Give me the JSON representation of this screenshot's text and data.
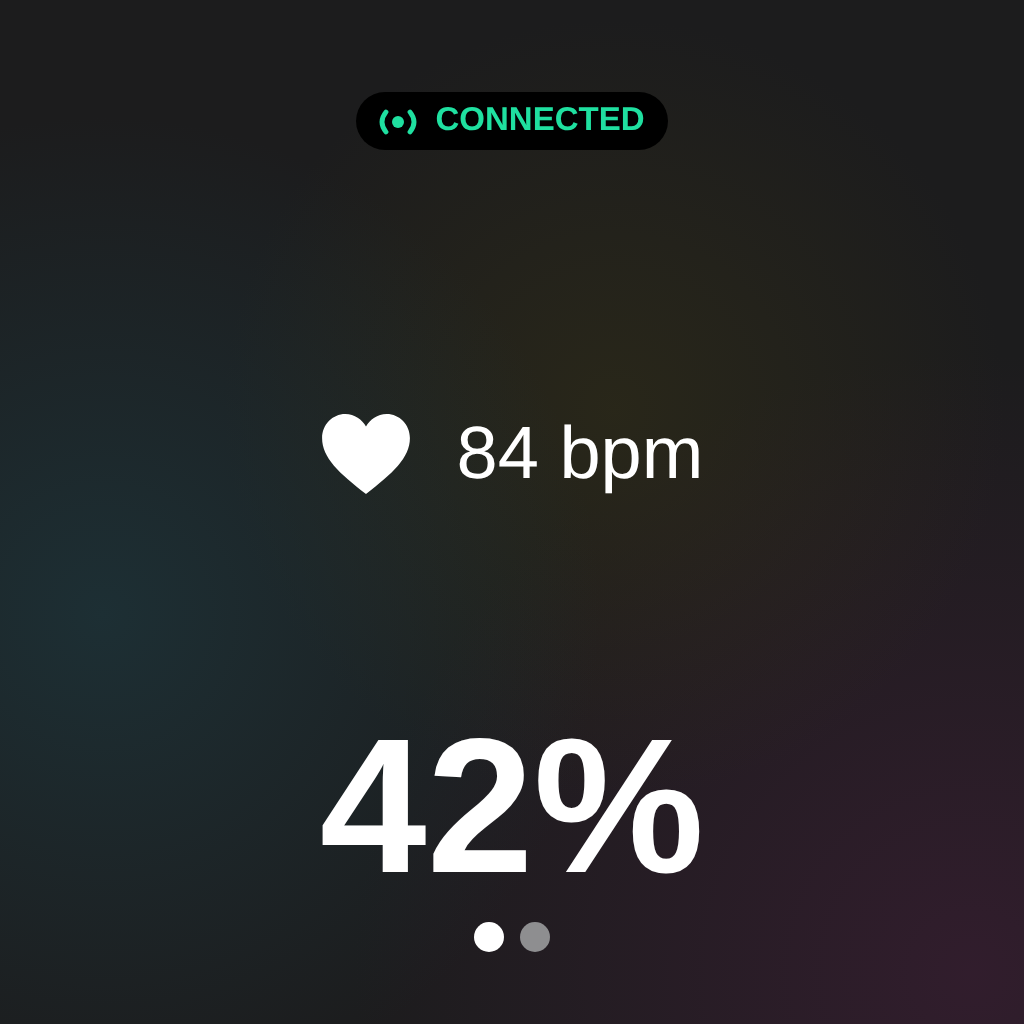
{
  "status": {
    "label": "CONNECTED",
    "connected": true
  },
  "heart_rate": {
    "reading": "84 bpm"
  },
  "battery": {
    "reading": "42%"
  },
  "pages": [
    {
      "selected": true
    },
    {
      "selected": false
    }
  ]
}
